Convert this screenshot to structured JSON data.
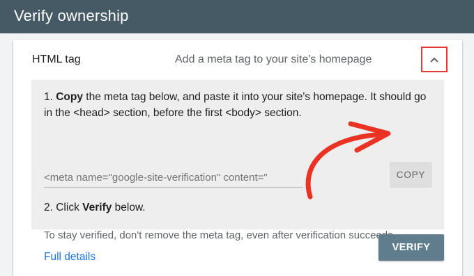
{
  "header": {
    "title": "Verify ownership"
  },
  "method": {
    "label": "HTML tag",
    "description": "Add a meta tag to your site's homepage",
    "collapse_icon": "chevron-up-icon",
    "highlight_color": "#e53935"
  },
  "instructions": {
    "step1_prefix": "1. ",
    "step1_bold": "Copy",
    "step1_text": " the meta tag below, and paste it into your site's homepage. It should go in the <head> section, before the first <body> section.",
    "meta_tag": "<meta name=\"google-site-verification\" content=\"",
    "copy_label": "COPY",
    "step2_prefix": "2. Click ",
    "step2_bold": "Verify",
    "step2_suffix": " below.",
    "note": "To stay verified, don't remove the meta tag, even after verification succeeds.",
    "full_details": "Full details"
  },
  "actions": {
    "verify_label": "VERIFY"
  },
  "colors": {
    "header_bg": "#455a64",
    "link": "#1a73e8",
    "verify_bg": "#5f7d8c",
    "annotation_arrow": "#ea3323"
  }
}
